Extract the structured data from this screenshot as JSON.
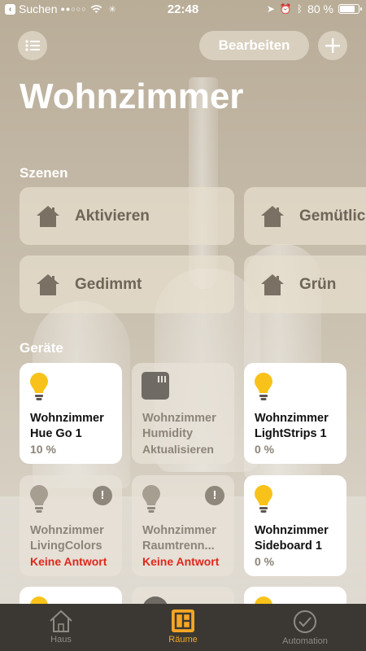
{
  "status_bar": {
    "back_app": "Suchen",
    "time": "22:48",
    "battery": "80 %",
    "battery_level": 0.8
  },
  "header": {
    "edit_label": "Bearbeiten",
    "add_icon": "plus-icon",
    "menu_icon": "list-icon",
    "title": "Wohnzimmer"
  },
  "scenes": {
    "label": "Szenen",
    "items": [
      {
        "label": "Aktivieren",
        "icon": "house-icon"
      },
      {
        "label": "Gemütlich",
        "icon": "house-icon"
      },
      {
        "label": "Gedimmt",
        "icon": "house-icon"
      },
      {
        "label": "Grün",
        "icon": "house-icon"
      }
    ]
  },
  "devices": {
    "label": "Geräte",
    "items": [
      {
        "line1": "Wohnzimmer",
        "line2": "Hue Go 1",
        "state": "10 %",
        "on": true,
        "icon": "bulb-icon"
      },
      {
        "line1": "Wohnzimmer",
        "line2": "Humidity",
        "state": "Aktualisieren",
        "on": false,
        "icon": "sensor-icon"
      },
      {
        "line1": "Wohnzimmer",
        "line2": "LightStrips 1",
        "state": "0 %",
        "on": true,
        "icon": "bulb-icon"
      },
      {
        "line1": "Wohnzimmer",
        "line2": "LivingColors",
        "state": "Keine Antwort",
        "on": false,
        "icon": "bulb-icon",
        "alert": "!"
      },
      {
        "line1": "Wohnzimmer",
        "line2": "Raumtrenn...",
        "state": "Keine Antwort",
        "on": false,
        "icon": "bulb-icon",
        "alert": "!"
      },
      {
        "line1": "Wohnzimmer",
        "line2": "Sideboard 1",
        "state": "0 %",
        "on": true,
        "icon": "bulb-icon"
      }
    ]
  },
  "tabbar": {
    "tabs": [
      {
        "label": "Haus",
        "icon": "house-icon",
        "active": false
      },
      {
        "label": "Räume",
        "icon": "rooms-icon",
        "active": true
      },
      {
        "label": "Automation",
        "icon": "clock-icon",
        "active": false
      }
    ]
  },
  "colors": {
    "accent": "#f5a623",
    "bulb_on": "#f8c21a",
    "error": "#e0271b",
    "tabbar_bg": "#3b3833"
  }
}
